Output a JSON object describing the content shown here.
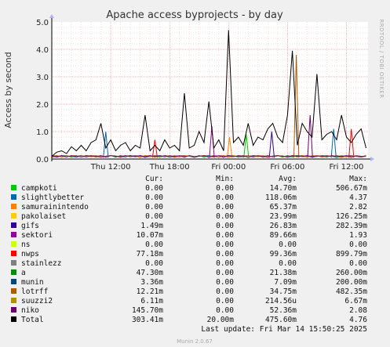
{
  "chart_data": {
    "type": "line",
    "title": "Apache access byprojects - by day",
    "ylabel": "Access by second",
    "side_label": "RRDTOOL / TOBI OETIKER",
    "footer": "Munin 2.0.67",
    "last_update": "Last update:  Fri Mar 14 15:50:25 2025",
    "ylim": [
      0,
      5.0
    ],
    "yticks": [
      {
        "v": 0.0,
        "label": "0.0"
      },
      {
        "v": 1.0,
        "label": "1.0"
      },
      {
        "v": 2.0,
        "label": "2.0"
      },
      {
        "v": 3.0,
        "label": "3.0"
      },
      {
        "v": 4.0,
        "label": "4.0"
      },
      {
        "v": 5.0,
        "label": "5.0"
      }
    ],
    "xlim": [
      0,
      30
    ],
    "xticks": [
      {
        "v": 6,
        "label": "Thu 12:00"
      },
      {
        "v": 12,
        "label": "Thu 18:00"
      },
      {
        "v": 18,
        "label": "Fri 00:00"
      },
      {
        "v": 24,
        "label": "Fri 06:00"
      },
      {
        "v": 30,
        "label": "Fri 12:00"
      }
    ],
    "grid": true,
    "legend_headers": [
      "Cur:",
      "Min:",
      "Avg:",
      "Max:"
    ],
    "series": [
      {
        "name": "campkoti",
        "color": "#00cc00",
        "cur": "0.00",
        "min": "0.00",
        "avg": "14.70m",
        "max": "506.67m"
      },
      {
        "name": "slightlybetter",
        "color": "#0066b3",
        "cur": "0.00",
        "min": "0.00",
        "avg": "118.06m",
        "max": "4.37"
      },
      {
        "name": "samurainintendo",
        "color": "#ff8000",
        "cur": "0.00",
        "min": "0.00",
        "avg": "65.37m",
        "max": "2.82"
      },
      {
        "name": "pakolaiset",
        "color": "#ffcc00",
        "cur": "0.00",
        "min": "0.00",
        "avg": "23.99m",
        "max": "126.25m"
      },
      {
        "name": "gifs",
        "color": "#330099",
        "cur": "1.49m",
        "min": "0.00",
        "avg": "26.83m",
        "max": "282.39m"
      },
      {
        "name": "sektori",
        "color": "#990099",
        "cur": "10.07m",
        "min": "0.00",
        "avg": "89.66m",
        "max": "1.93"
      },
      {
        "name": "ns",
        "color": "#ccff00",
        "cur": "0.00",
        "min": "0.00",
        "avg": "0.00",
        "max": "0.00"
      },
      {
        "name": "nwps",
        "color": "#ff0000",
        "cur": "77.18m",
        "min": "0.00",
        "avg": "99.36m",
        "max": "899.79m"
      },
      {
        "name": "stainlezz",
        "color": "#808080",
        "cur": "0.00",
        "min": "0.00",
        "avg": "0.00",
        "max": "0.00"
      },
      {
        "name": "a",
        "color": "#008f00",
        "cur": "47.30m",
        "min": "0.00",
        "avg": "21.38m",
        "max": "260.00m"
      },
      {
        "name": "munin",
        "color": "#00487d",
        "cur": "3.36m",
        "min": "0.00",
        "avg": "7.09m",
        "max": "200.00m"
      },
      {
        "name": "lotrff",
        "color": "#b35a00",
        "cur": "12.21m",
        "min": "0.00",
        "avg": "34.75m",
        "max": "482.35m"
      },
      {
        "name": "suuzzi2",
        "color": "#b38f00",
        "cur": "6.11m",
        "min": "0.00",
        "avg": "214.56u",
        "max": "6.67m"
      },
      {
        "name": "niko",
        "color": "#6b006b",
        "cur": "145.70m",
        "min": "0.00",
        "avg": "52.36m",
        "max": "2.08"
      },
      {
        "name": "Total",
        "color": "#000000",
        "cur": "303.41m",
        "min": "20.00m",
        "avg": "475.60m",
        "max": "4.76"
      }
    ],
    "total_line": {
      "x": [
        0.0,
        0.5,
        1.0,
        1.5,
        2.0,
        2.5,
        3.0,
        3.5,
        4.0,
        4.5,
        5.0,
        5.5,
        6.0,
        6.5,
        7.0,
        7.5,
        8.0,
        8.5,
        9.0,
        9.5,
        10.0,
        10.5,
        11.0,
        11.5,
        12.0,
        12.5,
        13.0,
        13.5,
        14.0,
        14.5,
        15.0,
        15.5,
        16.0,
        16.5,
        17.0,
        17.5,
        18.0,
        18.5,
        19.0,
        19.5,
        20.0,
        20.5,
        21.0,
        21.5,
        22.0,
        22.5,
        23.0,
        23.5,
        24.0,
        24.5,
        25.0,
        25.5,
        26.0,
        26.5,
        27.0,
        27.5,
        28.0,
        28.5,
        29.0,
        29.5,
        30.0,
        30.5,
        31.0,
        31.5,
        32.0
      ],
      "y": [
        0.1,
        0.25,
        0.3,
        0.2,
        0.45,
        0.3,
        0.5,
        0.3,
        0.6,
        0.7,
        1.3,
        0.4,
        0.7,
        0.3,
        0.5,
        0.6,
        0.3,
        0.5,
        0.4,
        1.6,
        0.3,
        0.5,
        0.3,
        0.7,
        0.4,
        0.5,
        0.3,
        2.4,
        0.4,
        0.5,
        1.0,
        0.6,
        2.1,
        0.4,
        0.7,
        0.3,
        4.7,
        0.6,
        0.8,
        0.5,
        1.3,
        0.5,
        0.8,
        0.7,
        1.1,
        1.3,
        0.8,
        0.6,
        1.6,
        3.95,
        0.5,
        1.3,
        1.0,
        0.8,
        3.1,
        0.7,
        0.9,
        1.0,
        0.7,
        1.6,
        0.8,
        0.6,
        0.9,
        1.1,
        0.4
      ]
    },
    "background_peaks": {
      "x": [
        5.5,
        10.5,
        16.3,
        18.1,
        19.8,
        22.4,
        24.9,
        26.3,
        28.7,
        30.5
      ],
      "y": [
        1.0,
        0.7,
        1.2,
        0.8,
        0.9,
        1.0,
        3.8,
        1.6,
        1.1,
        1.1
      ]
    }
  }
}
